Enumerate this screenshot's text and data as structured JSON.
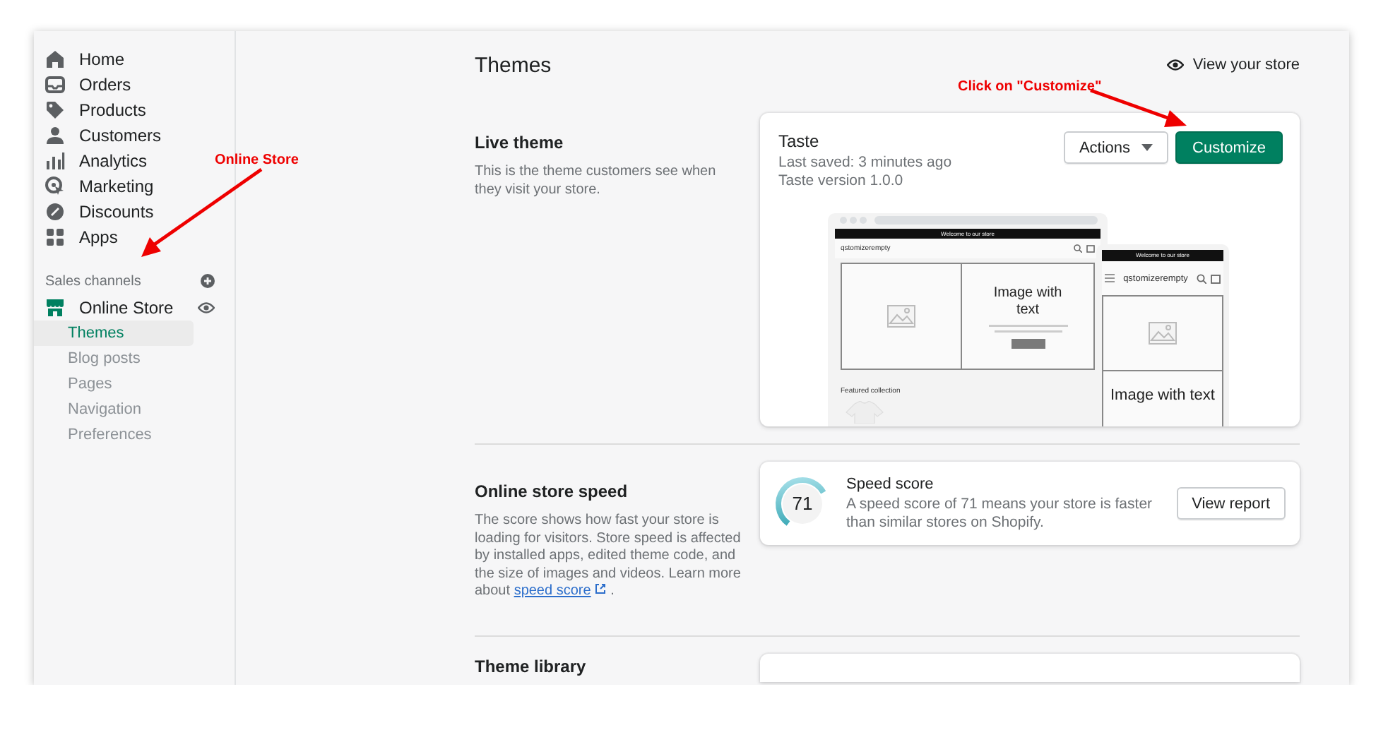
{
  "sidebar": {
    "items": [
      {
        "label": "Home"
      },
      {
        "label": "Orders"
      },
      {
        "label": "Products"
      },
      {
        "label": "Customers"
      },
      {
        "label": "Analytics"
      },
      {
        "label": "Marketing"
      },
      {
        "label": "Discounts"
      },
      {
        "label": "Apps"
      }
    ],
    "section_title": "Sales channels",
    "channel": {
      "label": "Online Store",
      "children": [
        {
          "label": "Themes",
          "selected": true
        },
        {
          "label": "Blog posts",
          "selected": false
        },
        {
          "label": "Pages",
          "selected": false
        },
        {
          "label": "Navigation",
          "selected": false
        },
        {
          "label": "Preferences",
          "selected": false
        }
      ]
    }
  },
  "header": {
    "title": "Themes",
    "link": "View your store"
  },
  "live_theme": {
    "heading": "Live theme",
    "description": "This is the theme customers see when they visit your store.",
    "theme_name": "Taste",
    "last_saved": "Last saved: 3 minutes ago",
    "version": "Taste version 1.0.0",
    "buttons": [
      {
        "label": "Actions",
        "kind": "menu"
      },
      {
        "label": "Customize",
        "kind": "primary"
      }
    ],
    "preview": {
      "desktop": {
        "announcement": "Welcome to our store",
        "store_name": "qstomizerempty",
        "heading": "Image with text",
        "collection": "Featured collection"
      },
      "mobile": {
        "announcement": "Welcome to our store",
        "store_name": "qstomizerempty",
        "heading": "Image with text"
      }
    }
  },
  "speed": {
    "heading": "Online store speed",
    "description": "The score shows how fast your store is loading for visitors. Store speed is affected by installed apps, edited theme code, and the size of images and videos. Learn more about",
    "link": "speed score",
    "after_link": ".",
    "score": "71",
    "title": "Speed score",
    "text": "A speed score of 71 means your store is faster than similar stores on Shopify.",
    "button": "View report"
  },
  "theme_library": {
    "heading": "Theme library"
  },
  "annotations": [
    {
      "text": "Online Store"
    },
    {
      "text": "Click on \"Customize\""
    }
  ]
}
